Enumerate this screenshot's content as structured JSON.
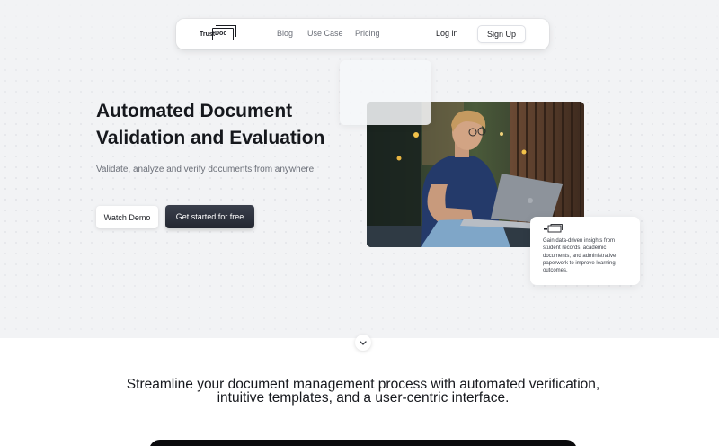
{
  "nav": {
    "logo_trust": "Trust",
    "logo_doc": "Doc",
    "links": [
      "Blog",
      "Use Case",
      "Pricing"
    ],
    "login": "Log in",
    "signup": "Sign Up"
  },
  "hero": {
    "headline_line1": "Automated Document",
    "headline_line2": "Validation and Evaluation",
    "subhead": "Validate, analyze and verify documents from anywhere.",
    "watch_demo": "Watch Demo",
    "get_started": "Get started for free"
  },
  "info_card": {
    "text": "Gain data-driven insights from student records, academic documents, and administrative paperwork to improve learning outcomes."
  },
  "section": {
    "tagline_line1": "Streamline your document management process with automated verification,",
    "tagline_line2": "intuitive templates, and a user-centric interface."
  },
  "icons": {
    "scroll": "chevron-down-icon",
    "logo": "trustdoc-logo"
  },
  "colors": {
    "hero_bg": "#f2f3f5",
    "primary_button": "#2a2e38",
    "dark_panel": "#0b0b0d"
  }
}
